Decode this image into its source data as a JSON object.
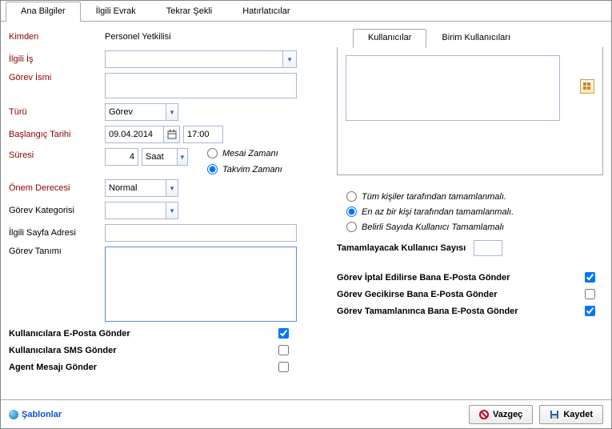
{
  "tabs": {
    "main": "Ana Bilgiler",
    "related": "İlgili Evrak",
    "repeat": "Tekrar Şekli",
    "reminders": "Hatırlatıcılar"
  },
  "labels": {
    "from": "Kimden",
    "related_work": "İlgili İş",
    "task_name": "Görev İsmi",
    "type": "Türü",
    "start_date": "Başlangıç Tarihi",
    "duration": "Süresi",
    "importance": "Önem Derecesi",
    "task_category": "Görev Kategorisi",
    "related_page": "İlgili Sayfa Adresi",
    "task_desc": "Görev Tanımı"
  },
  "values": {
    "from": "Personel Yetkilisi",
    "related_work": "",
    "task_name": "",
    "type": "Görev",
    "start_date": "09.04.2014",
    "start_time": "17:00",
    "duration_value": "4",
    "duration_unit": "Saat",
    "importance": "Normal",
    "task_category": "",
    "related_page": "",
    "task_desc": ""
  },
  "time_type": {
    "work": "Mesai Zamanı",
    "calendar": "Takvim Zamanı"
  },
  "inner_tabs": {
    "users": "Kullanıcılar",
    "unit_users": "Birim Kullanıcıları"
  },
  "completion": {
    "all": "Tüm kişiler tarafından tamamlanmalı.",
    "one": "En az bir kişi tarafından tamamlanmalı.",
    "count": "Belirli Sayıda Kullanıcı Tamamlamalı",
    "count_label": "Tamamlayacak Kullanıcı Sayısı",
    "count_value": ""
  },
  "notifications": {
    "send_email_users": "Kullanıcılara E-Posta Gönder",
    "send_sms_users": "Kullanıcılara SMS Gönder",
    "send_agent_msg": "Agent Mesajı Gönder",
    "on_cancel": "Görev İptal Edilirse Bana E-Posta Gönder",
    "on_delay": "Görev Gecikirse Bana E-Posta Gönder",
    "on_complete": "Görev Tamamlanınca Bana E-Posta Gönder"
  },
  "footer": {
    "templates": "Şablonlar",
    "cancel": "Vazgeç",
    "save": "Kaydet"
  }
}
